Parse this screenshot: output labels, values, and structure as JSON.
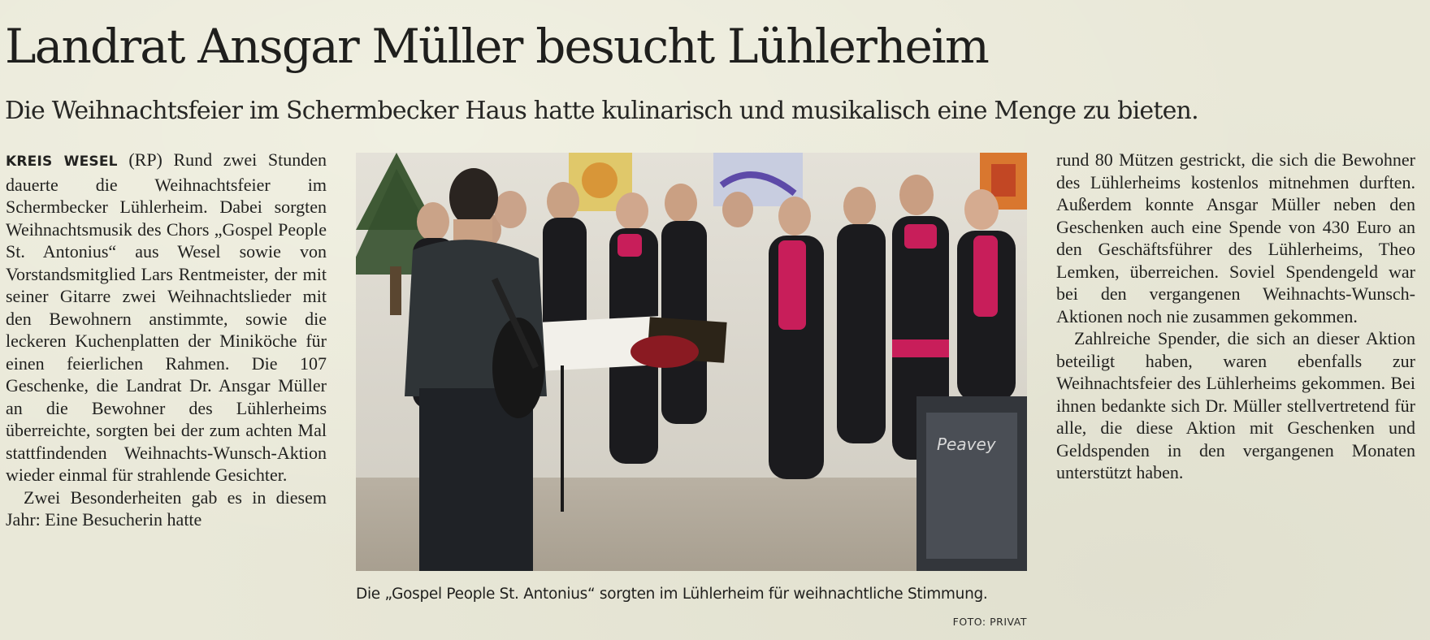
{
  "article": {
    "headline": "Landrat Ansgar Müller besucht Lühlerheim",
    "subheadline": "Die Weihnachtsfeier im Schermbecker Haus hatte kulinarisch und musikalisch eine Menge zu bieten.",
    "dateline": "KREIS WESEL",
    "left_column": {
      "p1": " (RP) Rund zwei Stunden dauerte die Weihnachtsfeier im Schermbecker Lühlerheim. Dabei sorgten Weihnachtsmusik des Chors „Gospel People St. Antonius“ aus Wesel sowie von Vorstandsmitglied Lars Rentmeister, der mit seiner Gitarre zwei Weihnachtslieder mit den Bewohnern anstimmte, sowie die leckeren Kuchenplatten der Miniköche für einen feierlichen Rahmen. Die 107 Geschenke, die Landrat Dr. Ansgar Müller an die Bewohner des Lühlerheims überreichte, sorgten bei der zum achten Mal stattfindenden Weihnachts-Wunsch-Aktion wieder einmal für strahlende Gesichter.",
      "p2": "Zwei Besonderheiten gab es in diesem Jahr: Eine Besucherin hatte"
    },
    "right_column": {
      "p1": "rund 80 Mützen gestrickt, die sich die Bewohner des Lühlerheims kostenlos mitnehmen durften. Außerdem konnte Ansgar Müller neben den Geschenken auch eine Spende von 430 Euro an den Geschäftsführer des Lühlerheims, Theo Lemken, überreichen. Soviel Spendengeld war bei den vergangenen Weihnachts-Wunsch-Aktionen noch nie zusammen gekommen.",
      "p2": "Zahlreiche Spender, die sich an dieser Aktion beteiligt haben, waren ebenfalls zur Weihnachtsfeier des Lühlerheims gekommen. Bei ihnen bedankte sich Dr. Müller stellvertretend für alle, die diese Aktion mit Geschenken und Geldspenden in den vergangenen Monaten unterstützt haben."
    },
    "photo": {
      "caption": "Die „Gospel People St. Antonius“ sorgten im Lühlerheim für weihnachtliche Stimmung.",
      "credit": "FOTO: PRIVAT",
      "amp_logo": "Peavey"
    }
  }
}
